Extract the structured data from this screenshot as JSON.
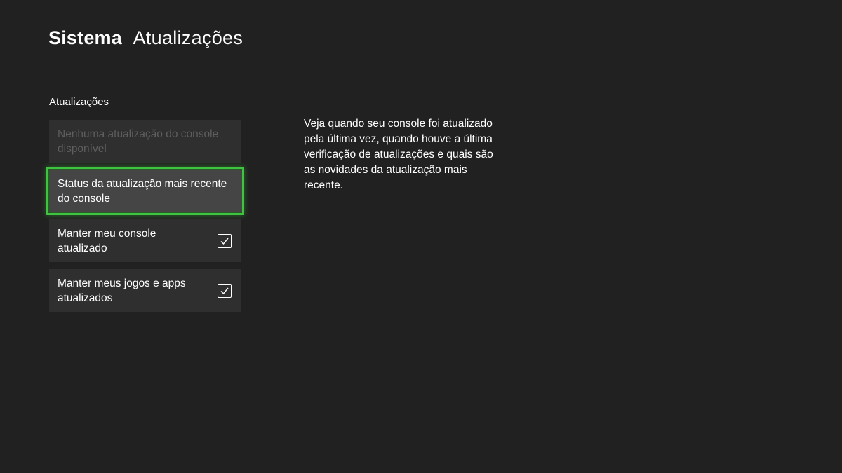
{
  "header": {
    "section": "Sistema",
    "subsection": "Atualizações"
  },
  "updates_group": {
    "label": "Atualizações",
    "items": [
      {
        "label": "Nenhuma atualização do console disponível",
        "state": "disabled"
      },
      {
        "label": "Status da atualização mais recente do console",
        "state": "focused"
      },
      {
        "label": "Manter meu console atualizado",
        "checked": true
      },
      {
        "label": "Manter meus jogos e apps atualizados",
        "checked": true
      }
    ]
  },
  "description": "Veja quando seu console foi atualizado pela última vez, quando houve a última verificação de atualizações e quais são as novidades da atualização mais recente.",
  "colors": {
    "background": "#212121",
    "item_background": "#2f2f2f",
    "focused_item_background": "#454545",
    "focus_ring": "#3ec43e",
    "disabled_text": "#5e5e5e",
    "text": "#ffffff"
  },
  "icons": {
    "checkbox": "checkbox-checked-icon"
  }
}
